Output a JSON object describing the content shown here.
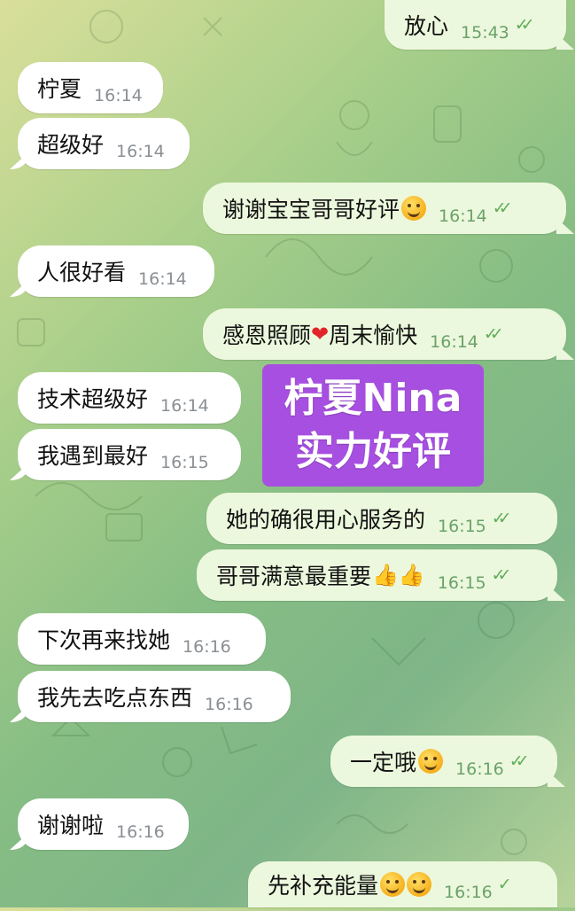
{
  "colors": {
    "incoming_bubble": "#ffffff",
    "outgoing_bubble": "#ecf8dd",
    "banner": "#a64fe0",
    "read_ticks": "#5fae5a"
  },
  "banner": {
    "line1": "柠夏Nina",
    "line2": "实力好评"
  },
  "messages": [
    {
      "dir": "out",
      "text": "放心",
      "time": "15:43",
      "ticks": "✓✓"
    },
    {
      "dir": "in",
      "text": "柠夏",
      "time": "16:14"
    },
    {
      "dir": "in",
      "text": "超级好",
      "time": "16:14"
    },
    {
      "dir": "out",
      "text": "谢谢宝宝哥哥好评",
      "emoji": "smile-emoji",
      "time": "16:14",
      "ticks": "✓✓"
    },
    {
      "dir": "in",
      "text": "人很好看",
      "time": "16:14"
    },
    {
      "dir": "out",
      "text": "感恩照顾",
      "text2": "周末愉快",
      "emoji": "heart-emoji",
      "time": "16:14",
      "ticks": "✓✓"
    },
    {
      "dir": "in",
      "text": "技术超级好",
      "time": "16:14"
    },
    {
      "dir": "in",
      "text": "我遇到最好",
      "time": "16:15"
    },
    {
      "dir": "out",
      "text": "她的确很用心服务的",
      "time": "16:15",
      "ticks": "✓✓"
    },
    {
      "dir": "out",
      "text": "哥哥满意最重要",
      "emoji": "thumbs-up-emoji",
      "time": "16:15",
      "ticks": "✓✓"
    },
    {
      "dir": "in",
      "text": "下次再来找她",
      "time": "16:16"
    },
    {
      "dir": "in",
      "text": "我先去吃点东西",
      "time": "16:16"
    },
    {
      "dir": "out",
      "text": "一定哦",
      "emoji": "smile-emoji",
      "time": "16:16",
      "ticks": "✓✓"
    },
    {
      "dir": "in",
      "text": "谢谢啦",
      "time": "16:16"
    },
    {
      "dir": "out",
      "text": "先补充能量",
      "emoji": "yum-emoji",
      "time": "16:16",
      "ticks": "✓"
    }
  ]
}
